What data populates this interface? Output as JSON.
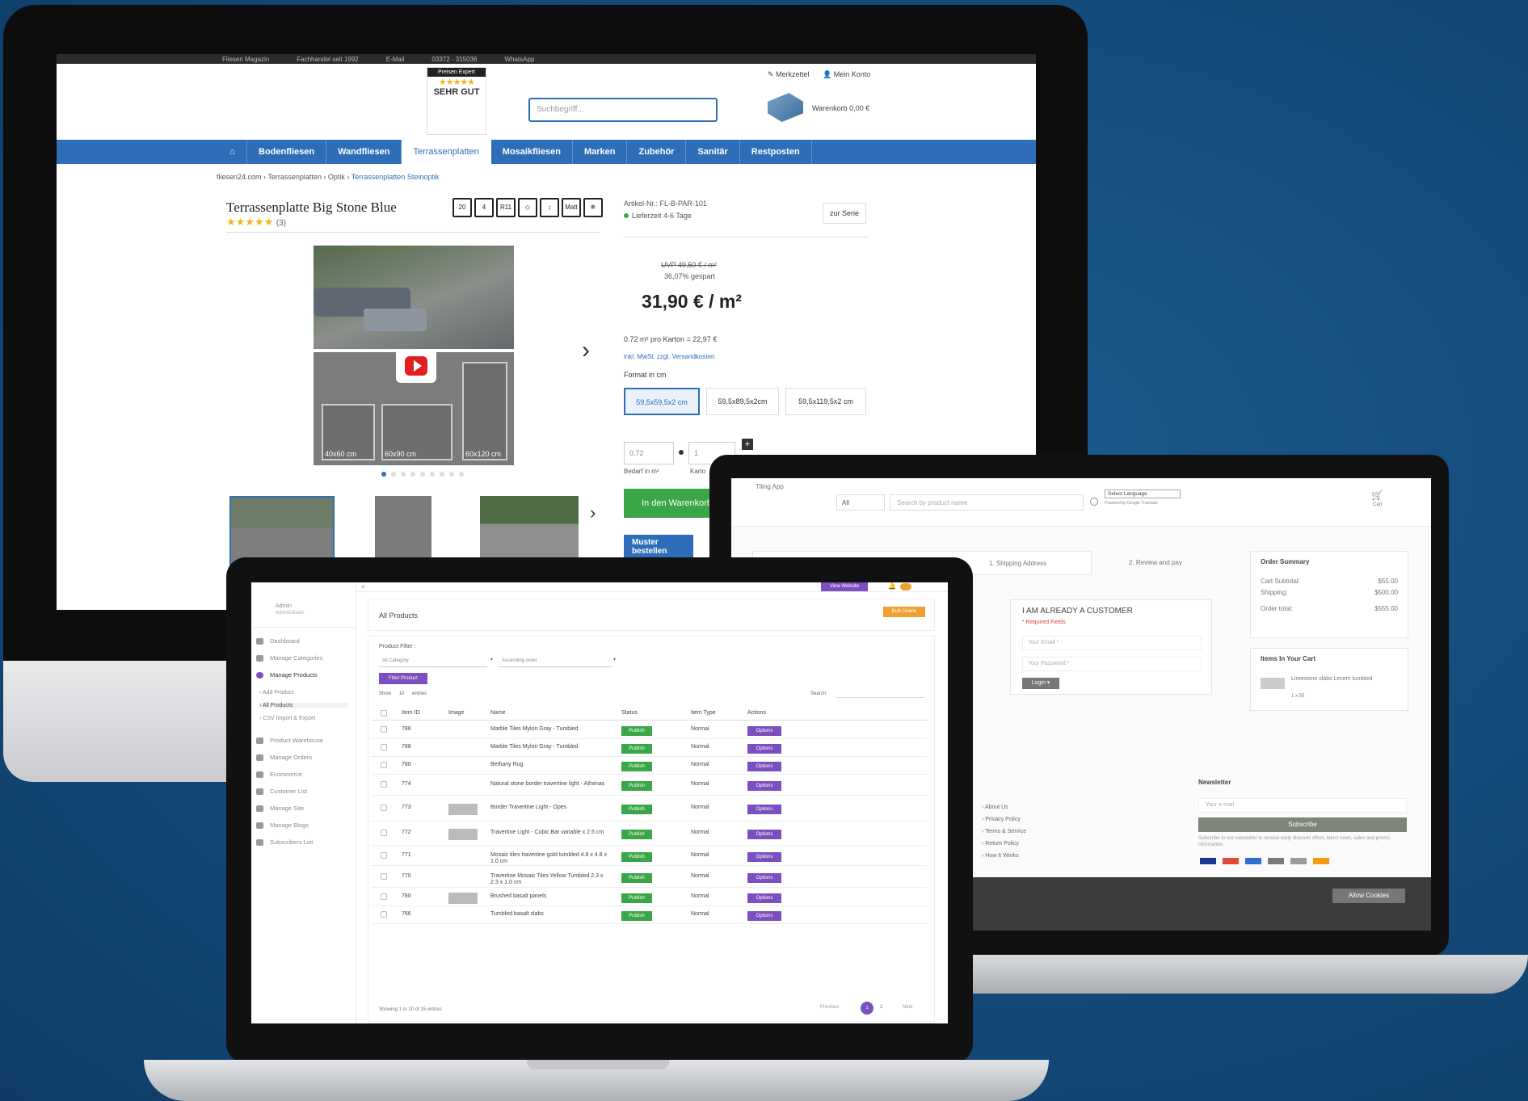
{
  "imac": {
    "topbar": {
      "items": [
        "Fliesen Magazin",
        "Fachhandel seit 1992",
        "E-Mail",
        "03372 - 315036",
        "WhatsApp"
      ]
    },
    "badge": {
      "top": "Preisen Expert",
      "grade": "SEHR GUT"
    },
    "search": {
      "placeholder": "Suchbegriff..."
    },
    "account": {
      "wishlist": "Merkzettel",
      "my_account": "Mein Konto",
      "cart": "Warenkorb 0,00 €"
    },
    "nav": {
      "items": [
        "Bodenfliesen",
        "Wandfliesen",
        "Terrassenplatten",
        "Mosaikfliesen",
        "Marken",
        "Zubehör",
        "Sanitär",
        "Restposten"
      ],
      "active": "Terrassenplatten"
    },
    "breadcrumb": {
      "items": [
        "fliesen24.com",
        "Terrassenplatten",
        "Optik"
      ],
      "last": "Terrassenplatten Steinoptik"
    },
    "product": {
      "title": "Terrassenplatte Big Stone Blue",
      "rating_count": "(3)",
      "icons": [
        "20",
        "4",
        "R11",
        "◇",
        "↕",
        "Matt",
        "❄"
      ],
      "tile_labels": [
        "40x60 cm",
        "60x90 cm",
        "60x120 cm"
      ],
      "article_no": "Artikel-Nr.: FL-B-PAR-101",
      "delivery": "Lieferzeit 4-6 Tage",
      "to_series": "zur Serie",
      "uvp": "UVP 49,50 € / m²",
      "saving": "36,07% gespart",
      "price": "31,90 € / m²",
      "per_carton": "0.72 m² pro Karton = 22,97 €",
      "vat_note": "inkl. MwSt. zzgl. Versandkosten",
      "format_label": "Format in cm",
      "formats": [
        "59,5x59,5x2 cm",
        "59,5x89,5x2cm",
        "59,5x119,5x2 cm"
      ],
      "qty_m2": "0.72",
      "qty_carton": "1",
      "need_label": "Bedarf in m²",
      "carton_label": "Karto",
      "add_to_cart": "In den Warenkorb",
      "sample": "Muster bestellen"
    }
  },
  "checkout": {
    "brand": "Tiling App",
    "category": "All",
    "search_placeholder": "Search by product name",
    "language": "Select Language",
    "translate_note": "Powered by Google Translate",
    "cart_label": "Cart",
    "steps": [
      "1. Shipping Address",
      "2. Review and pay"
    ],
    "login": {
      "title": "I AM ALREADY A CUSTOMER",
      "required": "* Required Fields",
      "email": "Your Email *",
      "password": "Your Password *",
      "button": "Login ▾"
    },
    "summary": {
      "title": "Order Summary",
      "rows": [
        [
          "Cart Subtotal:",
          "$55.00"
        ],
        [
          "Shipping:",
          "$500.00"
        ],
        [
          "Order total:",
          "$555.00"
        ]
      ]
    },
    "items": {
      "title": "Items In Your Cart",
      "name": "Limestone slabs Lecem tumbled",
      "meta": "1 x 55"
    },
    "links": [
      "About Us",
      "Privacy Policy",
      "Terms & Service",
      "Return Policy",
      "How It Works"
    ],
    "newsletter": {
      "title": "Newsletter",
      "placeholder": "Your e-mail",
      "button": "Subscribe",
      "note": "Subscribe to our newsletter to receive early discount offers, latest news, sales and promo information."
    },
    "cookie_button": "Allow Cookies"
  },
  "admin": {
    "header_btn": "View Website",
    "user": {
      "name": "Admin",
      "role": "Administrator"
    },
    "menu": [
      "Dashboard",
      "Manage Categories",
      "Manage Products",
      "Product Warehouse",
      "Manage Orders",
      "Ecommerce",
      "Customer List",
      "Manage Site",
      "Manage Blogs",
      "Subscribers List"
    ],
    "submenu": [
      "Add Product",
      "All Products",
      "CSV Import & Export"
    ],
    "page_title": "All Products",
    "bulk_btn": "Bulk Delete",
    "filter_label": "Product Filter :",
    "category_select": "All Category",
    "order_select": "Ascending order",
    "filter_btn": "Filter Product",
    "show": "Show",
    "show_value": "10",
    "entries": "entries",
    "search_label": "Search:",
    "columns": [
      "Item ID",
      "Image",
      "Name",
      "Status",
      "Item Type",
      "Actions"
    ],
    "rows": [
      {
        "id": "786",
        "name": "Marble Tiles Mylon Gray - Tumbled",
        "status": "Publish",
        "type": "Normal",
        "action": "Options"
      },
      {
        "id": "788",
        "name": "Marble Tiles Mylon Gray - Tumbled",
        "status": "Publish",
        "type": "Normal",
        "action": "Options"
      },
      {
        "id": "780",
        "name": "Bethany Rug",
        "status": "Publish",
        "type": "Normal",
        "action": "Options"
      },
      {
        "id": "774",
        "name": "Natural stone border travertine light - Athenas",
        "status": "Publish",
        "type": "Normal",
        "action": "Options"
      },
      {
        "id": "773",
        "name": "Border Travertine Light - Opes",
        "status": "Publish",
        "type": "Normal",
        "action": "Options"
      },
      {
        "id": "772",
        "name": "Travertine Light - Cubic Bar variable x 2.5 cm",
        "status": "Publish",
        "type": "Normal",
        "action": "Options"
      },
      {
        "id": "771",
        "name": "Mosaic tiles travertine gold tumbled 4.8 x 4.8 x 1.0 cm",
        "status": "Publish",
        "type": "Normal",
        "action": "Options"
      },
      {
        "id": "770",
        "name": "Travertine Mosaic Tiles Yellow Tumbled 2.3 x 2.3 x 1.0 cm",
        "status": "Publish",
        "type": "Normal",
        "action": "Options"
      },
      {
        "id": "780",
        "name": "Brushed basalt panels",
        "status": "Publish",
        "type": "Normal",
        "action": "Options"
      },
      {
        "id": "766",
        "name": "Tumbled basalt slabs",
        "status": "Publish",
        "type": "Normal",
        "action": "Options"
      }
    ],
    "footer_info": "Showing 1 to 10 of 15 entries",
    "pagination": {
      "prev": "Previous",
      "page1": "1",
      "page2": "2",
      "next": "Next"
    }
  },
  "colors": {
    "background": "#154d7d",
    "brand_blue": "#2e6db7",
    "green": "#3aa648",
    "purple": "#7b4fbf",
    "orange": "#f0a030"
  }
}
